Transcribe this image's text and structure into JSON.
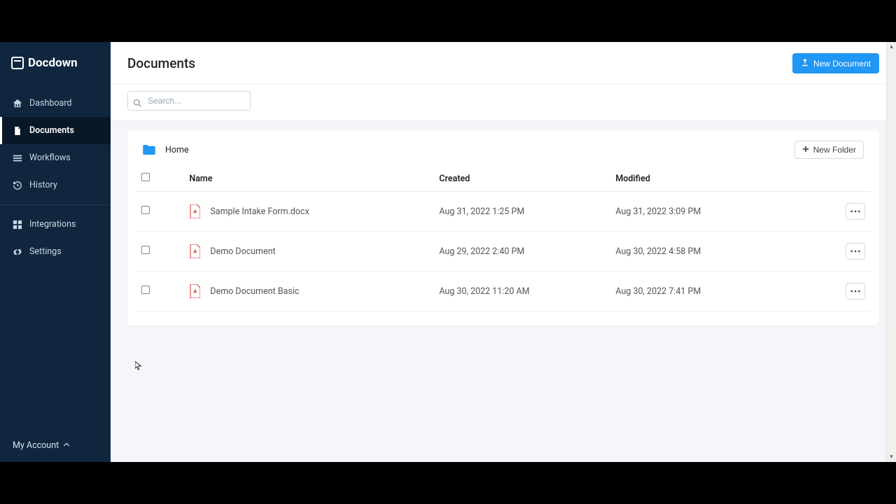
{
  "brand": {
    "name": "Docdown"
  },
  "sidebar": {
    "items": [
      {
        "label": "Dashboard"
      },
      {
        "label": "Documents"
      },
      {
        "label": "Workflows"
      },
      {
        "label": "History"
      },
      {
        "label": "Integrations"
      },
      {
        "label": "Settings"
      }
    ],
    "account_label": "My Account"
  },
  "header": {
    "title": "Documents",
    "new_doc_label": "New Document"
  },
  "search": {
    "placeholder": "Search..."
  },
  "breadcrumb": {
    "home": "Home"
  },
  "panel": {
    "new_folder_label": "New Folder"
  },
  "table": {
    "columns": {
      "name": "Name",
      "created": "Created",
      "modified": "Modified"
    },
    "rows": [
      {
        "name": "Sample Intake Form.docx",
        "created": "Aug 31, 2022 1:25 PM",
        "modified": "Aug 31, 2022 3:09 PM"
      },
      {
        "name": "Demo Document",
        "created": "Aug 29, 2022 2:40 PM",
        "modified": "Aug 30, 2022 4:58 PM"
      },
      {
        "name": "Demo Document Basic",
        "created": "Aug 30, 2022 11:20 AM",
        "modified": "Aug 30, 2022 7:41 PM"
      }
    ]
  }
}
